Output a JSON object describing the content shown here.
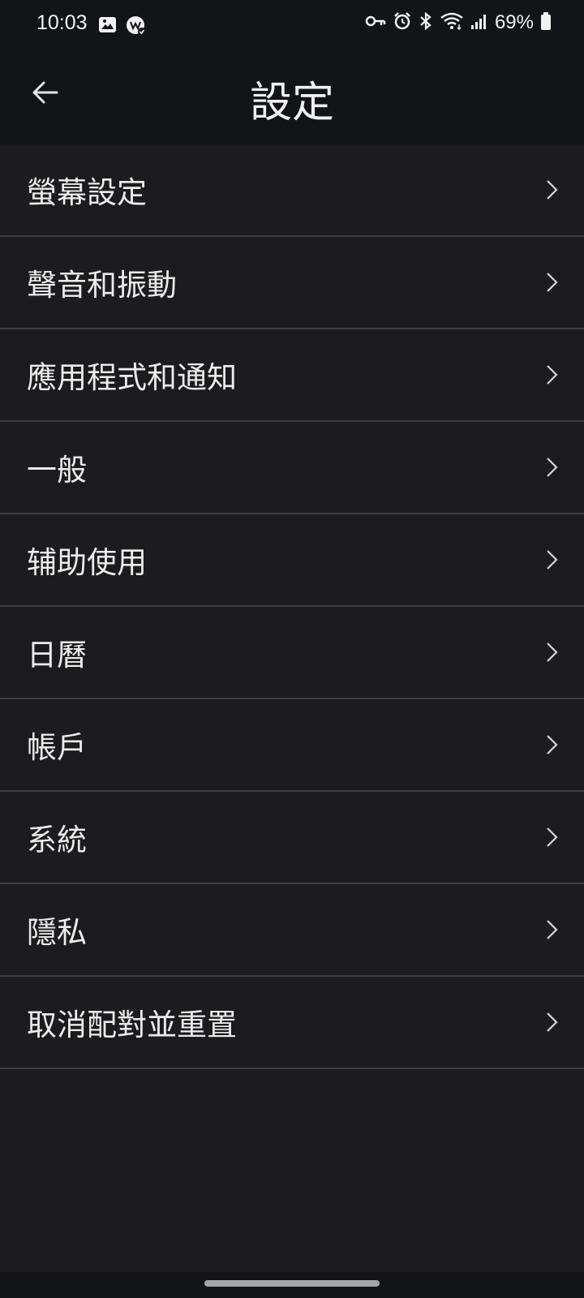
{
  "status_bar": {
    "time": "10:03",
    "battery": "69%",
    "left_icons": [
      "gallery-icon",
      "app-notification-icon"
    ],
    "right_icons": [
      "vpn-key-icon",
      "alarm-icon",
      "bluetooth-icon",
      "wifi-icon",
      "signal-icon",
      "battery-icon"
    ]
  },
  "header": {
    "title": "設定",
    "back_icon": "arrow-back-icon"
  },
  "settings": {
    "items": [
      {
        "label": "螢幕設定"
      },
      {
        "label": "聲音和振動"
      },
      {
        "label": "應用程式和通知"
      },
      {
        "label": "一般"
      },
      {
        "label": "辅助使用"
      },
      {
        "label": "日曆"
      },
      {
        "label": "帳戶"
      },
      {
        "label": "系統"
      },
      {
        "label": "隱私"
      },
      {
        "label": "取消配對並重置"
      }
    ]
  },
  "colors": {
    "background": "#1c1c1e",
    "header_background": "#131418",
    "divider": "#3e3e41",
    "text": "#ececec"
  }
}
